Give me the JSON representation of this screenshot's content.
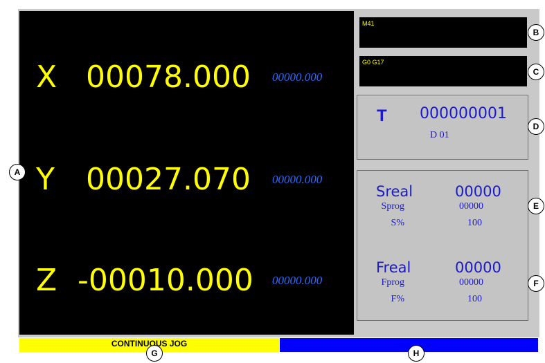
{
  "axes": [
    {
      "letter": "X",
      "value": "00078.000",
      "secondary": "00000.000"
    },
    {
      "letter": "Y",
      "value": "00027.070",
      "secondary": "00000.000"
    },
    {
      "letter": "Z",
      "value": "-00010.000",
      "secondary": "00000.000"
    }
  ],
  "m_codes": "M41",
  "g_codes": "G0 G17",
  "tool": {
    "letter": "T",
    "number": "000000001",
    "d": "D  01"
  },
  "spindle": {
    "real_label": "Sreal",
    "real_value": "00000",
    "prog_label": "Sprog",
    "prog_value": "00000",
    "pct_label": "S%",
    "pct_value": "100"
  },
  "feed": {
    "real_label": "Freal",
    "real_value": "00000",
    "prog_label": "Fprog",
    "prog_value": "00000",
    "pct_label": "F%",
    "pct_value": "100"
  },
  "status": {
    "mode": "CONTINUOUS JOG"
  },
  "callouts": {
    "a": "A",
    "b": "B",
    "c": "C",
    "d": "D",
    "e": "E",
    "f": "F",
    "g": "G",
    "h": "H"
  },
  "colors": {
    "dro_bg": "#000000",
    "dro_text": "#ffff00",
    "secondary_text": "#2f6bff",
    "panel_text": "#1a1acc",
    "status_left": "#ffff00",
    "status_right": "#0000ff"
  }
}
